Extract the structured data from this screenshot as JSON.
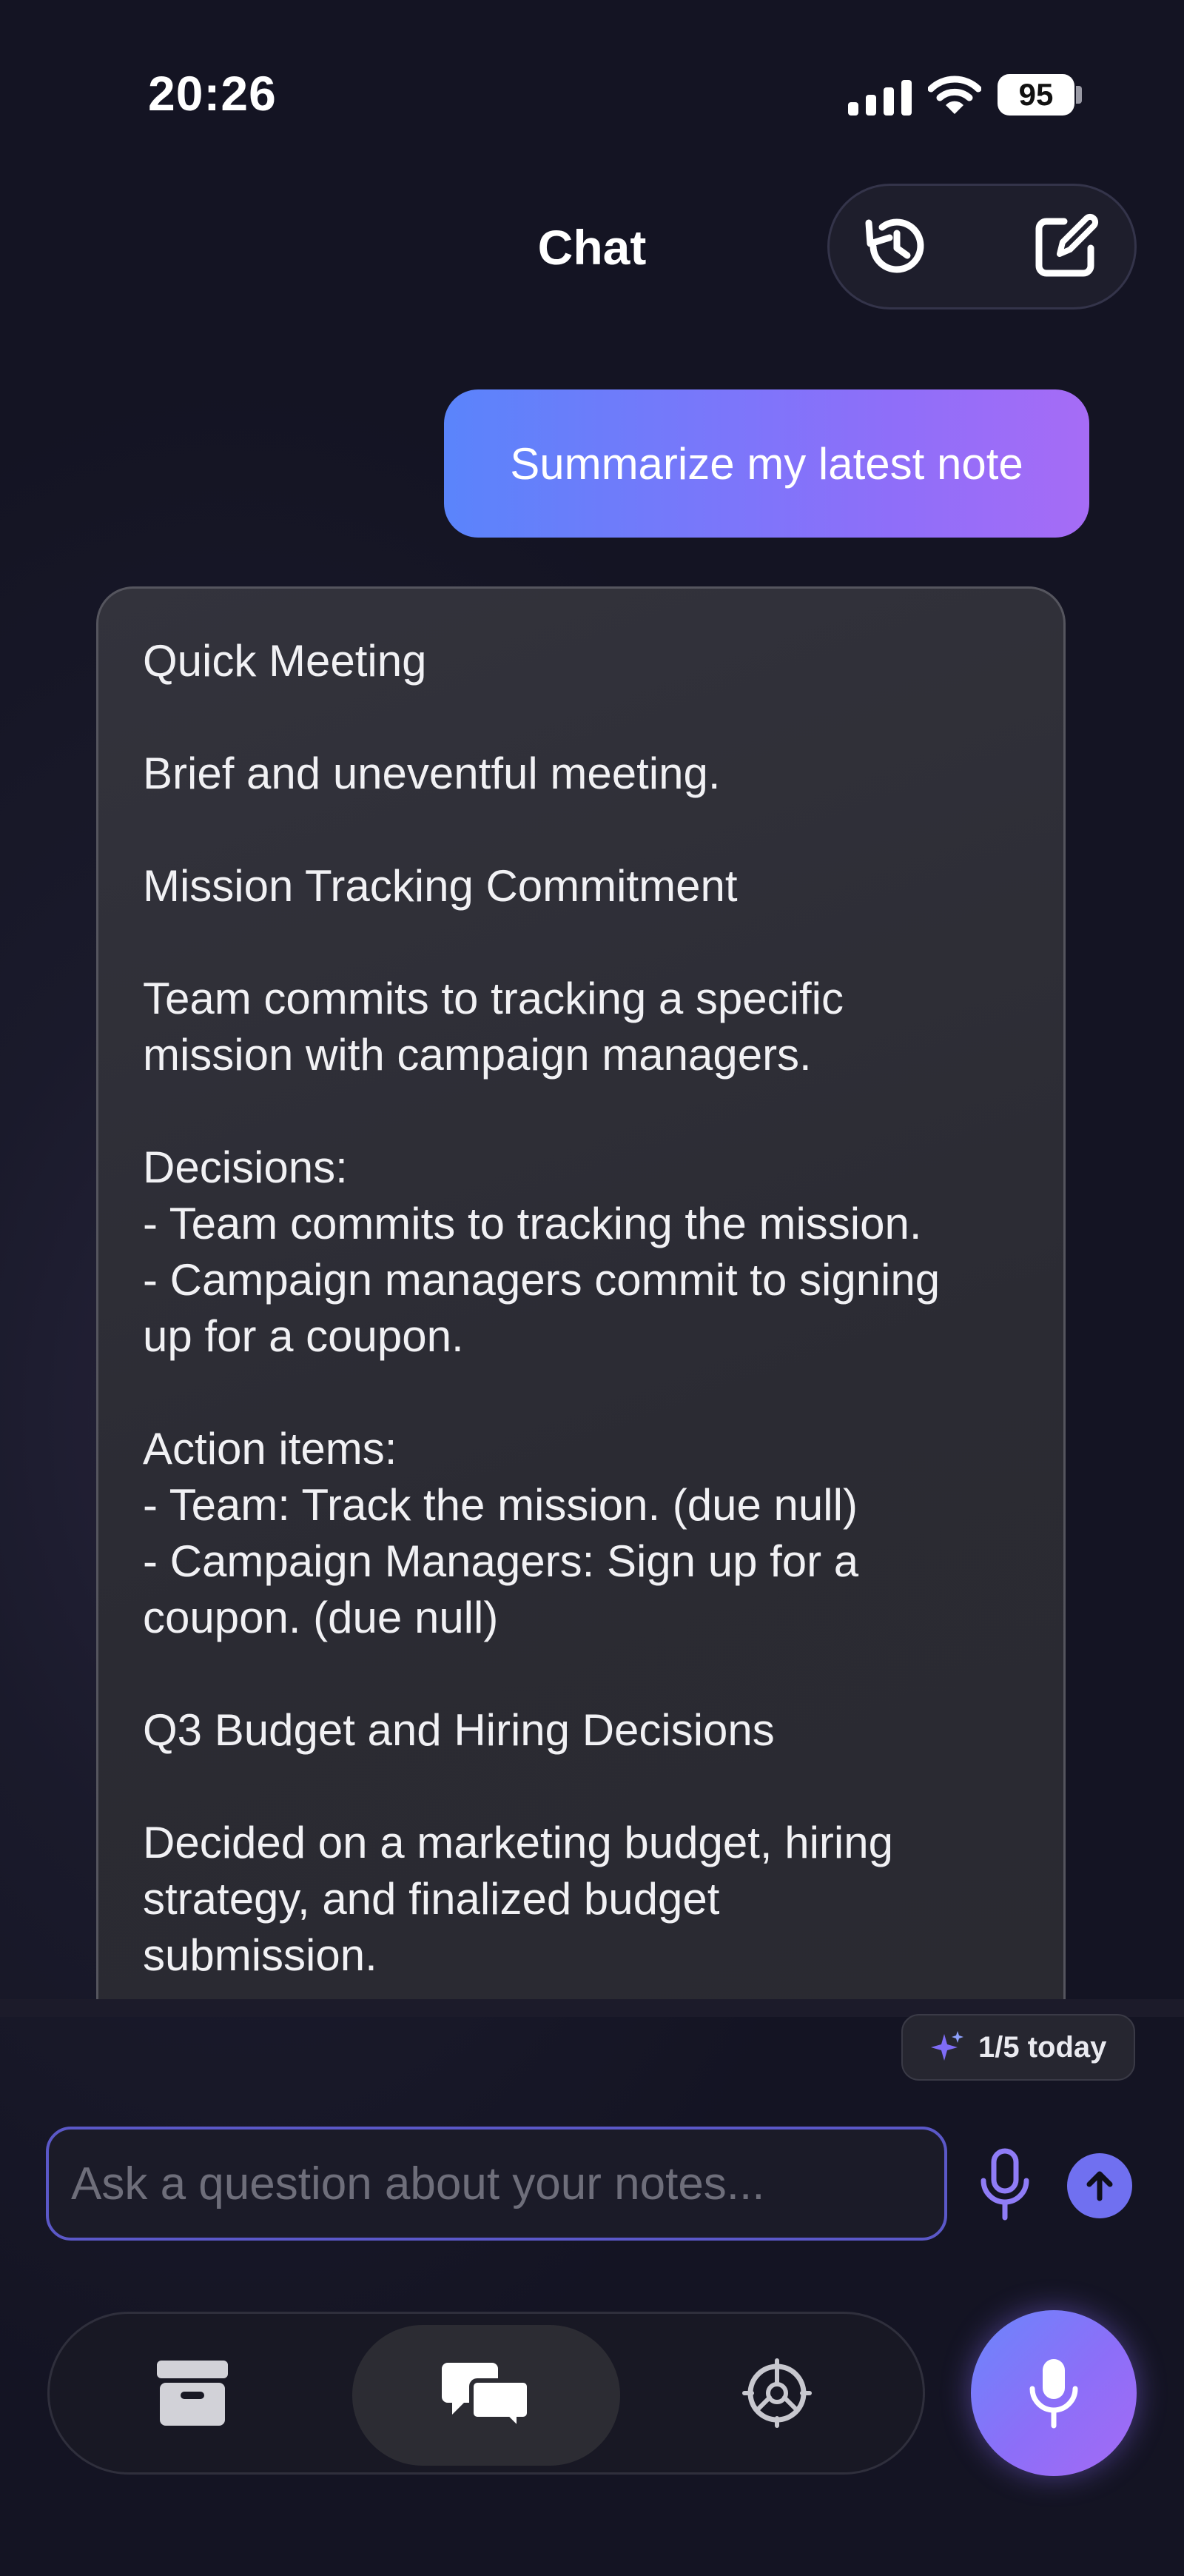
{
  "status_bar": {
    "time": "20:26",
    "battery": "95",
    "icons": [
      "signal-icon",
      "wifi-icon",
      "battery-icon"
    ]
  },
  "header": {
    "title": "Chat",
    "actions": [
      "history-icon",
      "compose-icon"
    ]
  },
  "messages": {
    "user": "Summarize my latest note",
    "assistant": "Quick Meeting\n\nBrief and uneventful meeting.\n\nMission Tracking Commitment\n\nTeam commits to tracking a specific\nmission with campaign managers.\n\nDecisions:\n- Team commits to tracking the mission.\n- Campaign managers commit to signing\nup for a coupon.\n\nAction items:\n- Team: Track the mission. (due null)\n- Campaign Managers: Sign up for a\ncoupon. (due null)\n\nQ3 Budget and Hiring Decisions\n\nDecided on a marketing budget, hiring\nstrategy, and finalized budget\nsubmission."
  },
  "usage": {
    "label": "1/5 today",
    "icon": "sparkle-icon"
  },
  "composer": {
    "placeholder": "Ask a question about your notes...",
    "value": "",
    "icons": [
      "microphone-icon",
      "send-arrow-icon"
    ]
  },
  "tab_bar": {
    "tabs": [
      "inbox-icon",
      "chat-icon",
      "settings-icon"
    ],
    "active": "chat",
    "record_icon": "microphone-icon"
  },
  "colors": {
    "accent": "#7070f0",
    "gradient_start": "#5a84fb",
    "gradient_end": "#a66cf6",
    "background": "#1a1a2b"
  }
}
